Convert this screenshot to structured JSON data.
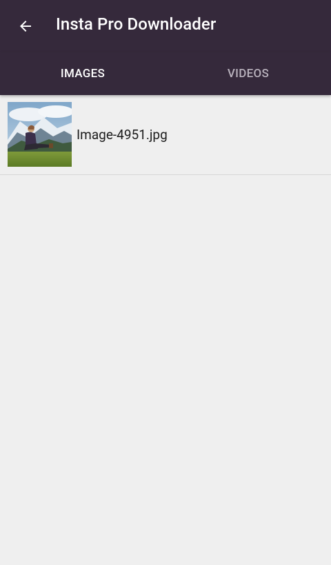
{
  "toolbar": {
    "back_icon": "arrow-left-icon",
    "title": "Insta Pro Downloader",
    "background": "#35293b"
  },
  "tabs": [
    {
      "label": "IMAGES",
      "active": true
    },
    {
      "label": "VIDEOS",
      "active": false
    }
  ],
  "files": [
    {
      "name": "Image-4951.jpg",
      "thumbnail": "mountain-meadow-person-thumbnail"
    }
  ]
}
